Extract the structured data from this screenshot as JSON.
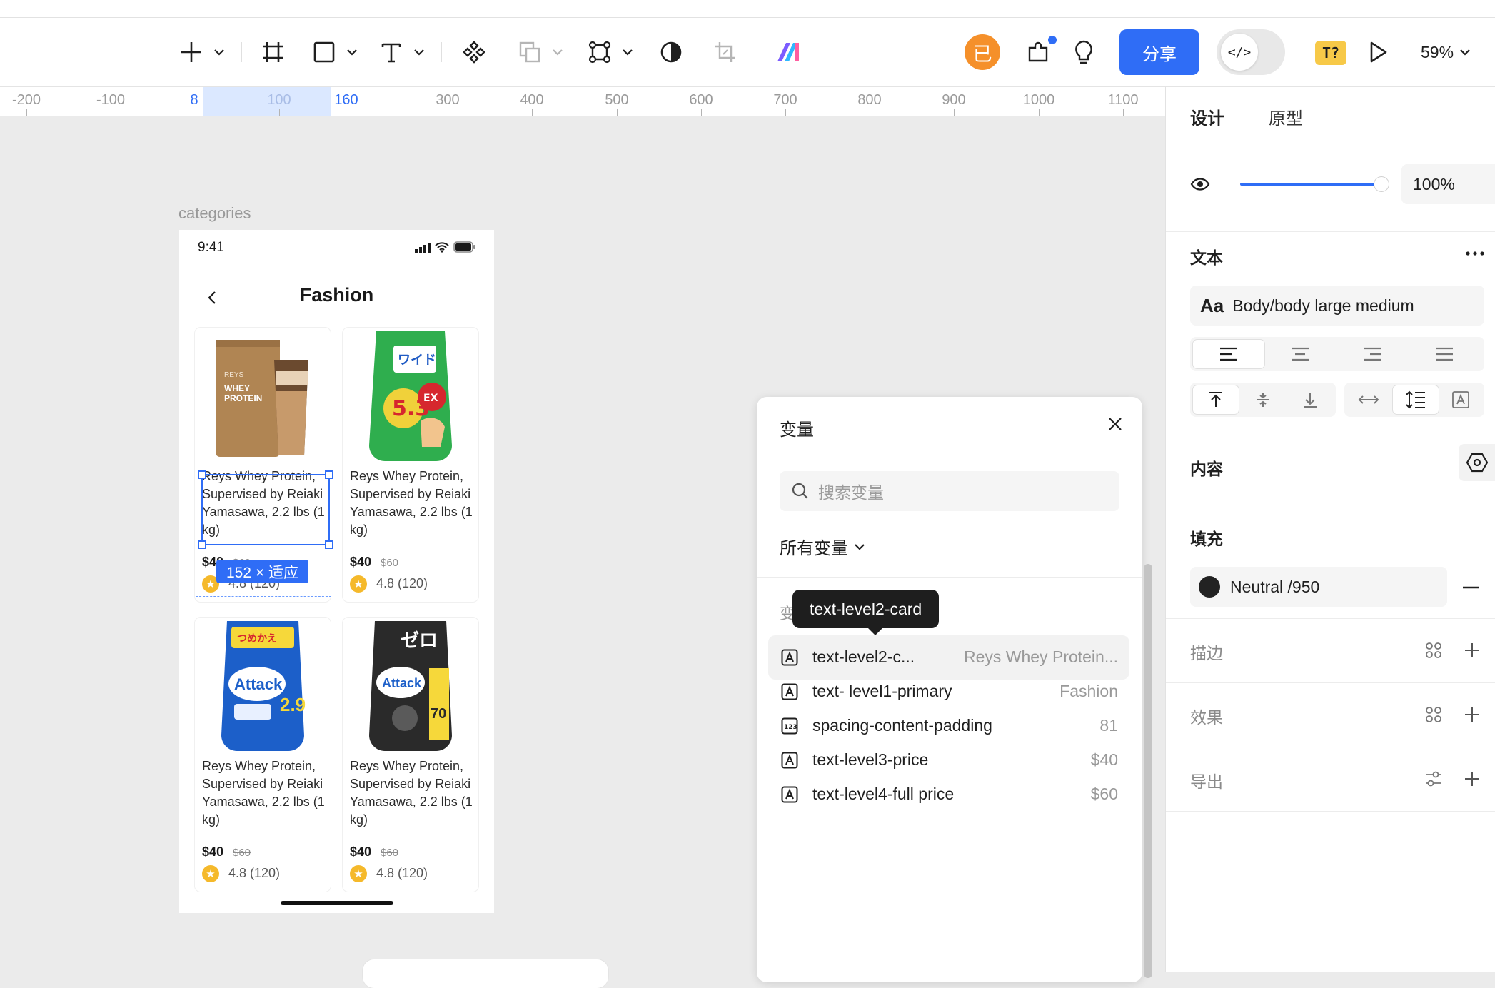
{
  "toolbar": {
    "avatar_initial": "已",
    "share_label": "分享",
    "code_label": "</>",
    "translate_badge": "T?",
    "zoom_label": "59%"
  },
  "ruler": {
    "labels": [
      "-200",
      "-100",
      "8",
      "100",
      "160",
      "300",
      "400",
      "500",
      "600",
      "700",
      "800",
      "900",
      "1000",
      "1100"
    ]
  },
  "canvas": {
    "frame_label": "categories",
    "status_time": "9:41",
    "page_title": "Fashion",
    "selection_size": "152 × 适应",
    "products": [
      {
        "title": "Reys Whey Protein, Supervised by Reiaki Yamasawa, 2.2 lbs (1 kg)",
        "price": "$40",
        "full_price": "$60",
        "rating": "4.8 (120)",
        "image": "protein-pouch"
      },
      {
        "title": "Reys Whey Protein, Supervised by Reiaki Yamasawa, 2.2 lbs (1 kg)",
        "price": "$40",
        "full_price": "$60",
        "rating": "4.8 (120)",
        "image": "detergent-green"
      },
      {
        "title": "Reys Whey Protein, Supervised by Reiaki Yamasawa, 2.2 lbs (1 kg)",
        "price": "$40",
        "full_price": "$60",
        "rating": "4.8 (120)",
        "image": "detergent-blue"
      },
      {
        "title": "Reys Whey Protein, Supervised by Reiaki Yamasawa, 2.2 lbs (1 kg)",
        "price": "$40",
        "full_price": "$60",
        "rating": "4.8 (120)",
        "image": "detergent-black"
      }
    ]
  },
  "variables_panel": {
    "title": "变量",
    "search_placeholder": "搜索变量",
    "filter_label": "所有变量",
    "section_label": "变",
    "tooltip": "text-level2-card",
    "rows": [
      {
        "type": "text",
        "name": "text-level2-c...",
        "value": "Reys Whey Protein..."
      },
      {
        "type": "text",
        "name": "text- level1-primary",
        "value": "Fashion"
      },
      {
        "type": "number",
        "name": "spacing-content-padding",
        "value": "81"
      },
      {
        "type": "text",
        "name": "text-level3-price",
        "value": "$40"
      },
      {
        "type": "text",
        "name": "text-level4-full price",
        "value": "$60"
      }
    ]
  },
  "properties_panel": {
    "tabs": [
      "设计",
      "原型"
    ],
    "opacity": "100%",
    "opacity_value": 1.0,
    "text_section": "文本",
    "text_style_prefix": "Aa",
    "text_style": "Body/body large medium",
    "content_section": "内容",
    "fill_section": "填充",
    "fill_name": "Neutral /950",
    "fill_color": "#222222",
    "stroke_section": "描边",
    "effect_section": "效果",
    "export_section": "导出"
  },
  "colors": {
    "accent": "#2f6df6",
    "avatar": "#f5902a",
    "badge": "#f7c948",
    "star": "#f5b92b"
  }
}
